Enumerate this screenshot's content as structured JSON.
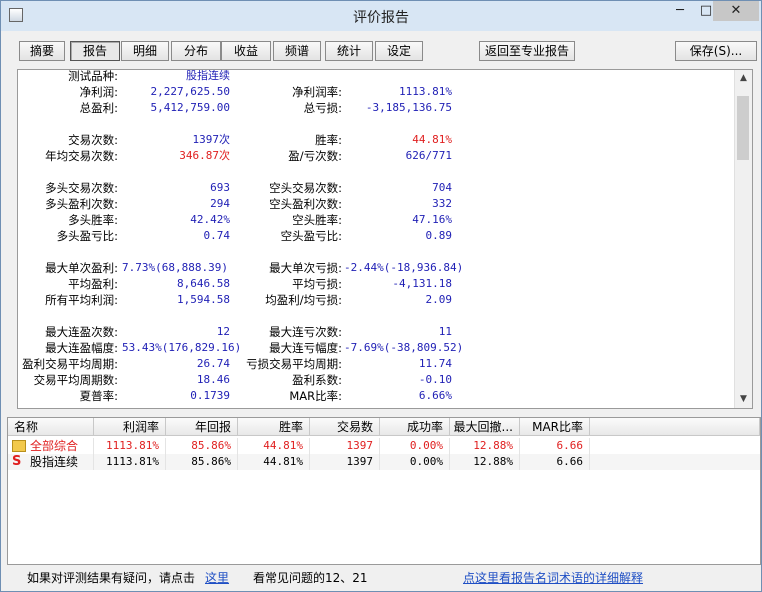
{
  "window": {
    "title": "评价报告",
    "min": "─",
    "max": "□",
    "close": "✕"
  },
  "toolbar": {
    "tabs": [
      "摘要",
      "报告",
      "明细",
      "分布",
      "收益",
      "频谱",
      "统计",
      "设定"
    ],
    "back_label": "返回至专业报告",
    "save_label": "保存(S)..."
  },
  "report": {
    "rows": [
      [
        {
          "l": "测试品种:",
          "v": "股指连续"
        },
        {
          "l": "",
          "v": ""
        }
      ],
      [
        {
          "l": "净利润:",
          "v": "2,227,625.50"
        },
        {
          "l": "净利润率:",
          "v": "1113.81%"
        }
      ],
      [
        {
          "l": "总盈利:",
          "v": "5,412,759.00"
        },
        {
          "l": "总亏损:",
          "v": "-3,185,136.75"
        }
      ],
      [],
      [
        {
          "l": "交易次数:",
          "v": "1397次"
        },
        {
          "l": "胜率:",
          "v": "44.81%"
        }
      ],
      [
        {
          "l": "年均交易次数:",
          "v": "346.87次"
        },
        {
          "l": "盈/亏次数:",
          "v": "626/771"
        }
      ],
      [],
      [
        {
          "l": "多头交易次数:",
          "v": "693"
        },
        {
          "l": "空头交易次数:",
          "v": "704"
        }
      ],
      [
        {
          "l": "多头盈利次数:",
          "v": "294"
        },
        {
          "l": "空头盈利次数:",
          "v": "332"
        }
      ],
      [
        {
          "l": "多头胜率:",
          "v": "42.42%"
        },
        {
          "l": "空头胜率:",
          "v": "47.16%"
        }
      ],
      [
        {
          "l": "多头盈亏比:",
          "v": "0.74"
        },
        {
          "l": "空头盈亏比:",
          "v": "0.89"
        }
      ],
      [],
      [
        {
          "l": "最大单次盈利:",
          "v": "7.73%(68,888.39)"
        },
        {
          "l": "最大单次亏损:",
          "v": "-2.44%(-18,936.84)"
        }
      ],
      [
        {
          "l": "平均盈利:",
          "v": "8,646.58"
        },
        {
          "l": "平均亏损:",
          "v": "-4,131.18"
        }
      ],
      [
        {
          "l": "所有平均利润:",
          "v": "1,594.58"
        },
        {
          "l": "均盈利/均亏损:",
          "v": "2.09"
        }
      ],
      [],
      [
        {
          "l": "最大连盈次数:",
          "v": "12"
        },
        {
          "l": "最大连亏次数:",
          "v": "11"
        }
      ],
      [
        {
          "l": "最大连盈幅度:",
          "v": "53.43%(176,829.16)"
        },
        {
          "l": "最大连亏幅度:",
          "v": "-7.69%(-38,809.52)"
        }
      ],
      [
        {
          "l": "盈利交易平均周期:",
          "v": "26.74"
        },
        {
          "l": "亏损交易平均周期:",
          "v": "11.74"
        }
      ],
      [
        {
          "l": "交易平均周期数:",
          "v": "18.46"
        },
        {
          "l": "盈利系数:",
          "v": "-0.10"
        }
      ],
      [
        {
          "l": "夏普率:",
          "v": "0.1739"
        },
        {
          "l": "MAR比率:",
          "v": "6.66%"
        }
      ]
    ]
  },
  "grid": {
    "headers": [
      "名称",
      "利润率",
      "年回报",
      "胜率",
      "交易数",
      "成功率",
      "最大回撤...",
      "MAR比率"
    ],
    "rows": [
      {
        "icon": "folder-icon",
        "cells": [
          "全部综合",
          "1113.81%",
          "85.86%",
          "44.81%",
          "1397",
          "0.00%",
          "12.88%",
          "6.66"
        ],
        "red": true
      },
      {
        "icon": "S",
        "cells": [
          "股指连续",
          "1113.81%",
          "85.86%",
          "44.81%",
          "1397",
          "0.00%",
          "12.88%",
          "6.66"
        ],
        "red": false
      }
    ]
  },
  "status": {
    "prefix": "如果对评测结果有疑问，请点击",
    "link1": "这里",
    "middle": "看常见问题的12、21",
    "link2": "点这里看报告名词术语的详细解释"
  }
}
